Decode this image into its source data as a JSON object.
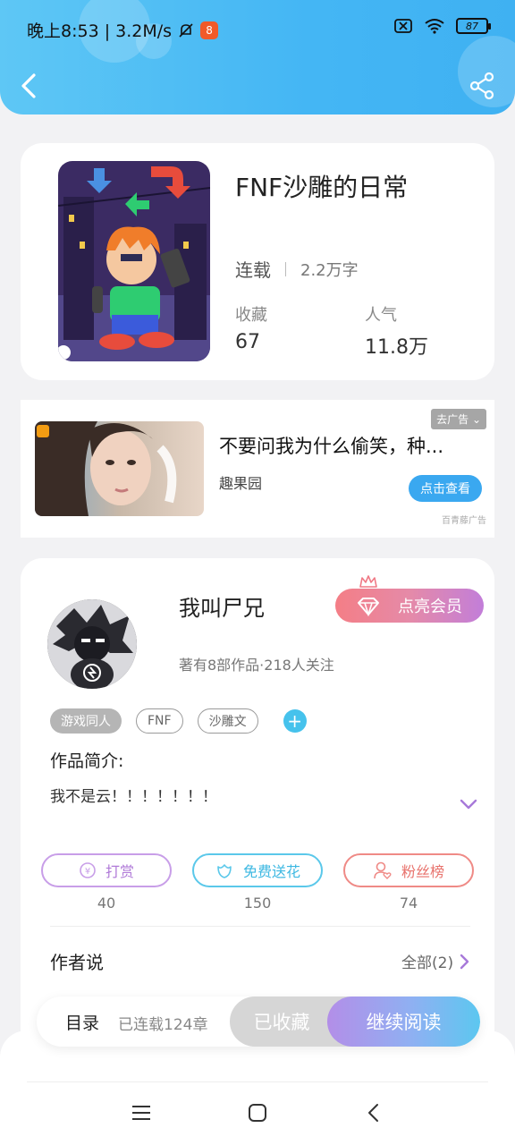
{
  "status_bar": {
    "time_speed": "晚上8:53 | 3.2M/s",
    "app_badge": "8",
    "battery": "87"
  },
  "book": {
    "title": "FNF沙雕的日常",
    "status": "连载",
    "words": "2.2万字",
    "favorites_label": "收藏",
    "favorites_value": "67",
    "popularity_label": "人气",
    "popularity_value": "11.8万"
  },
  "ad": {
    "title": "不要问我为什么偷笑，种...",
    "source": "趣果园",
    "remove_label": "去广告",
    "cta_label": "点击查看",
    "provider": "百青藤广告"
  },
  "author": {
    "name": "我叫尸兄",
    "meta": "著有8部作品·218人关注",
    "vip_label": "点亮会员",
    "tags": [
      "游戏同人",
      "FNF",
      "沙雕文"
    ],
    "intro_title": "作品简介:",
    "intro_text": "我不是云！！！！！！！"
  },
  "actions": {
    "tip_label": "打赏",
    "tip_count": "40",
    "flower_label": "免费送花",
    "flower_count": "150",
    "fans_label": "粉丝榜",
    "fans_count": "74"
  },
  "author_says": {
    "title": "作者说",
    "all_label": "全部(2)"
  },
  "read_bar": {
    "toc_label": "目录",
    "toc_count": "已连载124章",
    "collected_label": "已收藏",
    "continue_label": "继续阅读"
  },
  "colors": {
    "header": "#44b6f4",
    "accent": "#3aa8f0",
    "vip_gradient_start": "#f47e86",
    "vip_gradient_end": "#c27ed9",
    "tip": "#c89ee8",
    "flower": "#5bc8ea",
    "fans": "#ef8a86"
  }
}
